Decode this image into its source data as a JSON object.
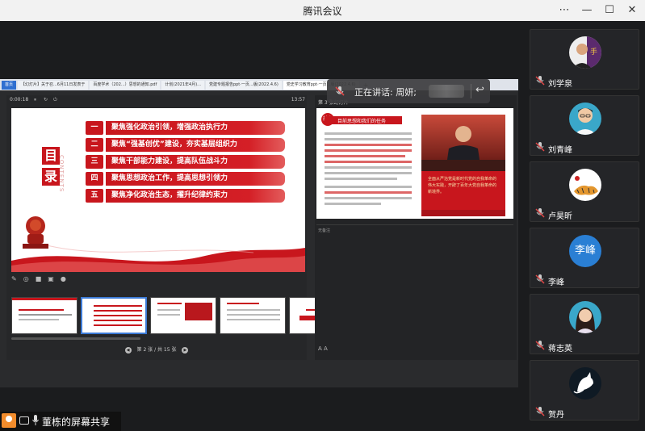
{
  "window": {
    "title": "腾讯会议",
    "controls": [
      "⋯",
      "—",
      "☐",
      "✕"
    ]
  },
  "speaking": {
    "label": "正在讲话: 周妍;"
  },
  "sharer": {
    "name": "董栋的屏幕共享"
  },
  "browser_tabs": [
    "首页",
    "【幻灯片】关于召...6月11日发表于",
    "百度学术（202...）思想的通知.pdf",
    "计划(2021年4月)...",
    "党建专题报告ppt·一页...版(2022.4.6)",
    "党史学习教育ppt·一页...版(2022.4.6)"
  ],
  "player": {
    "elapsed": "0:00:18",
    "clock": "13:57",
    "pager": "第 2 张 / 共 15 张"
  },
  "slide_main": {
    "mulu": [
      "目",
      "录"
    ],
    "mulu_en": "CONTENTS",
    "items": [
      {
        "num": "一",
        "text": "聚焦强化政治引领，增强政治执行力"
      },
      {
        "num": "二",
        "text": "聚焦“强基创优”建设，夯实基层组织力"
      },
      {
        "num": "三",
        "text": "聚焦干部能力建设，提高队伍战斗力"
      },
      {
        "num": "四",
        "text": "聚焦思想政治工作，提高思想引领力"
      },
      {
        "num": "五",
        "text": "聚焦净化政治生态，擢升纪律约束力"
      }
    ]
  },
  "right_pane": {
    "label": "第 3 张幻灯片",
    "next_slide": {
      "badge": "前言",
      "header": "目前思想和我们的任务",
      "quote": "全面从严治党是新时代党的自我革命的伟大实践，开辟了百年大党自我革命的新境界。"
    },
    "notes_label": "无备注"
  },
  "participants": [
    {
      "name": "刘学泉"
    },
    {
      "name": "刘青峰"
    },
    {
      "name": "卢昊昕"
    },
    {
      "name": "李峰",
      "avatar_text": "李峰"
    },
    {
      "name": "蒋志英"
    },
    {
      "name": "贺丹"
    }
  ],
  "colors": {
    "party_red": "#c8161d",
    "background": "#1b1c1e",
    "titlebar": "#f2f2f2",
    "avatar_blue": "#2a7fd4"
  }
}
